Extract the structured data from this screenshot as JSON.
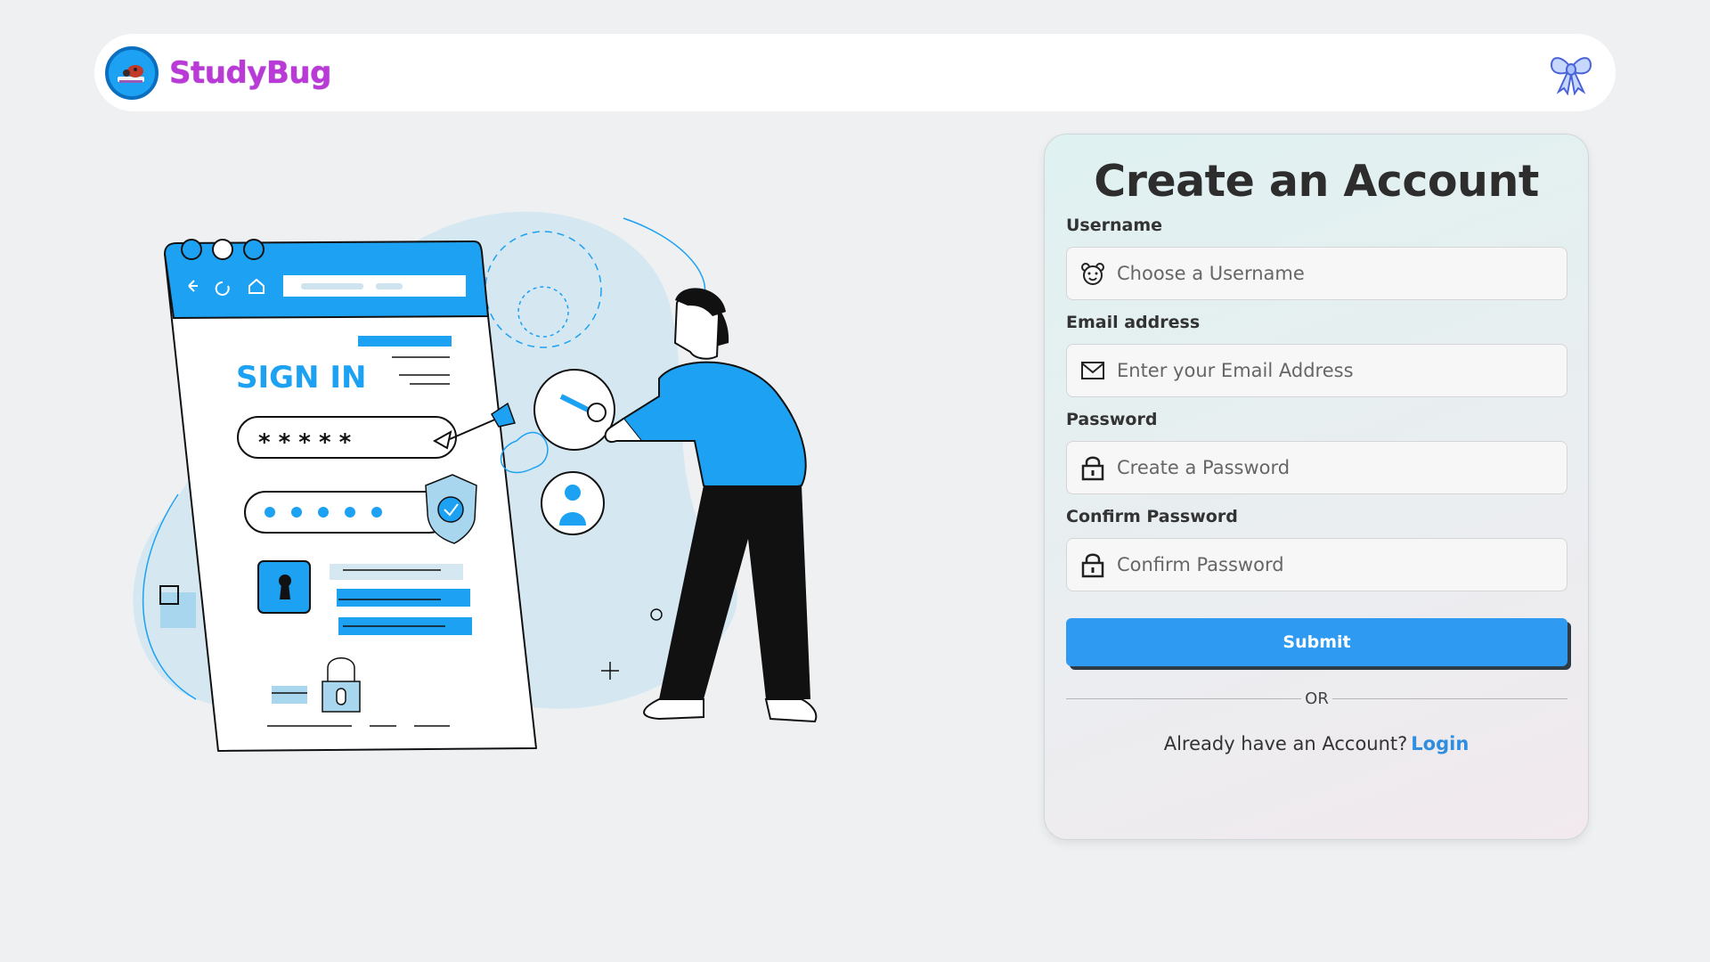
{
  "header": {
    "brand": "StudyBug"
  },
  "illustration": {
    "heading": "SIGN IN",
    "password_mask": "* * * * *"
  },
  "form": {
    "title": "Create an Account",
    "fields": [
      {
        "label": "Username",
        "placeholder": "Choose a Username",
        "icon": "bear-icon"
      },
      {
        "label": "Email address",
        "placeholder": "Enter your Email Address",
        "icon": "envelope-icon"
      },
      {
        "label": "Password",
        "placeholder": "Create a Password",
        "icon": "lock-icon"
      },
      {
        "label": "Confirm Password",
        "placeholder": "Confirm Password",
        "icon": "lock-icon"
      }
    ],
    "submit_label": "Submit",
    "divider_text": "OR",
    "login_prompt": "Already have an Account?",
    "login_link": "Login"
  },
  "colors": {
    "accent": "#2f9af2",
    "brand": "#b93ad7",
    "illustration_blue": "#1da1f2"
  }
}
